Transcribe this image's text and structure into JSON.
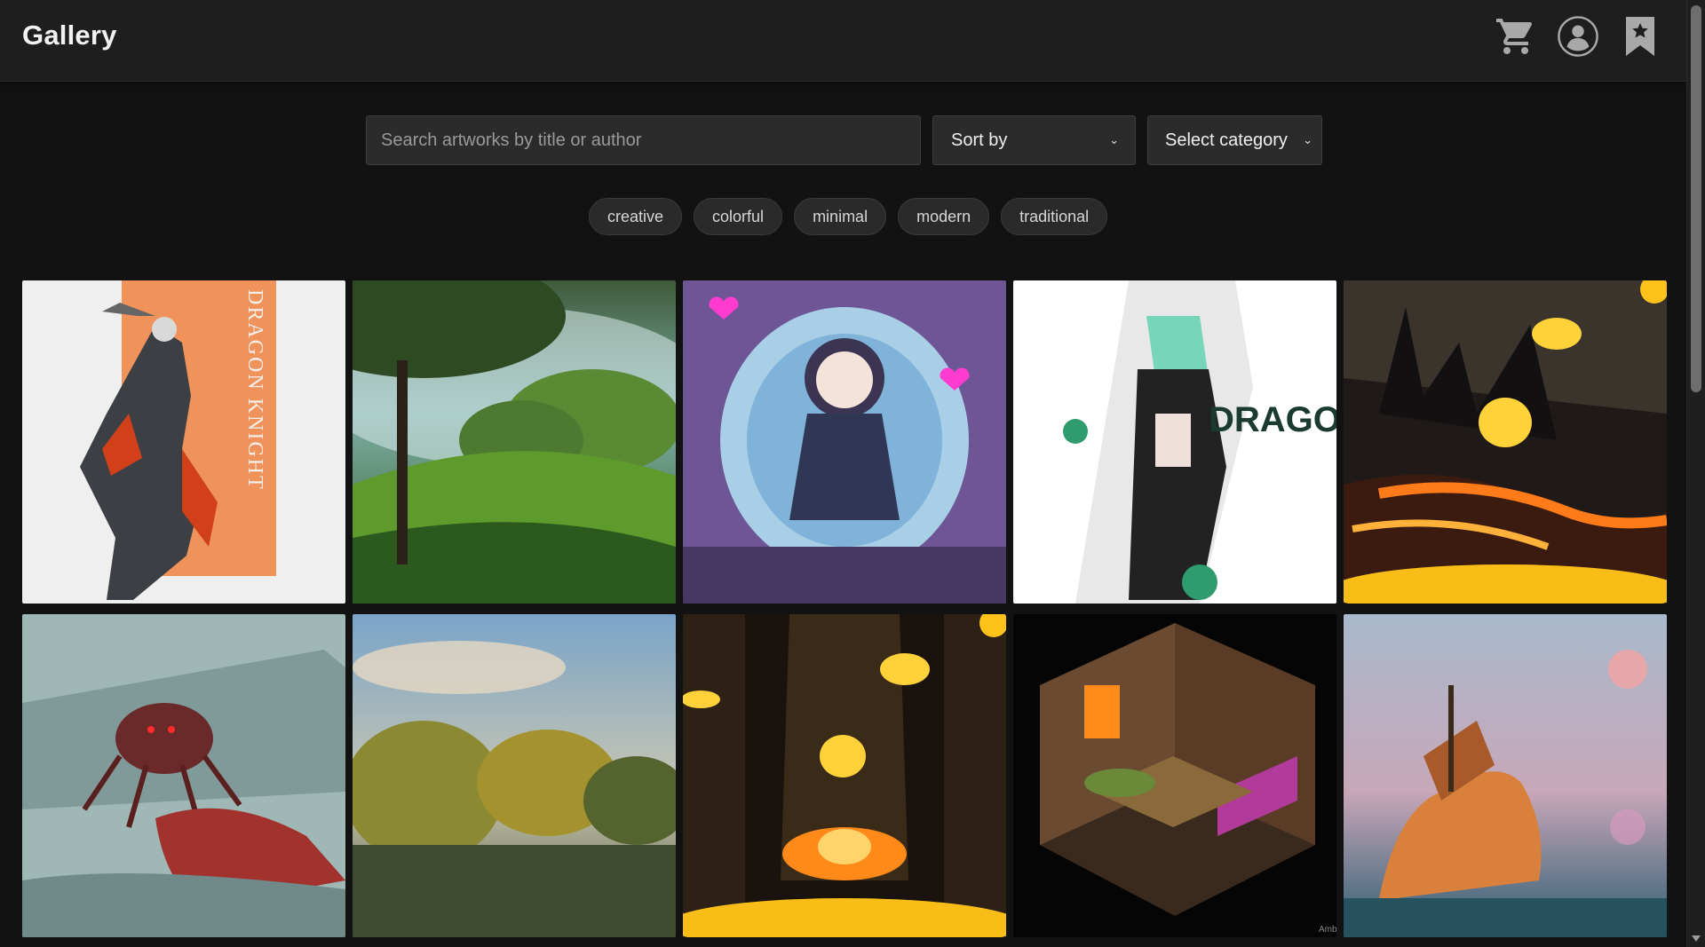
{
  "header": {
    "title": "Gallery",
    "icons": [
      "cart-icon",
      "user-icon",
      "bookmark-icon"
    ]
  },
  "search": {
    "placeholder": "Search artworks by title or author",
    "value": ""
  },
  "sort": {
    "label": "Sort by"
  },
  "category": {
    "label": "Select category"
  },
  "tags": [
    "creative",
    "colorful",
    "minimal",
    "modern",
    "traditional"
  ],
  "artworks_row1": [
    {
      "id": "art-dragon-knight"
    },
    {
      "id": "art-orchard-meadow"
    },
    {
      "id": "art-celestial-maiden"
    },
    {
      "id": "art-green-hair-warrior"
    },
    {
      "id": "art-lava-coins"
    }
  ],
  "artworks_row2": [
    {
      "id": "art-foggy-crab-robot"
    },
    {
      "id": "art-painted-treeline"
    },
    {
      "id": "art-temple-fire-coins"
    },
    {
      "id": "art-isometric-room"
    },
    {
      "id": "art-ship-island"
    }
  ],
  "art_text": {
    "dragon_title": "DRAGON KNIGHT",
    "dragon_banner": "DRAGON KIV",
    "watermark": "Amb"
  },
  "colors": {
    "background": "#121212",
    "header": "#1e1e1e",
    "input": "#2b2b2b"
  }
}
